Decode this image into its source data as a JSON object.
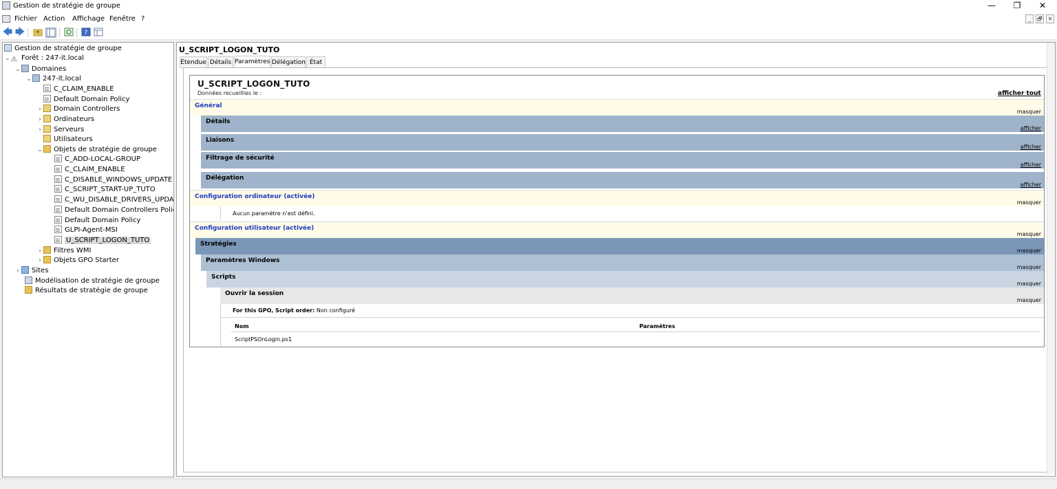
{
  "window": {
    "title": "Gestion de stratégie de groupe",
    "minimize": "—",
    "restore": "❐",
    "close": "✕"
  },
  "menu": {
    "items": [
      "Fichier",
      "Action",
      "Affichage",
      "Fenêtre",
      "?"
    ],
    "child_controls": [
      "_",
      "🗗",
      "✕"
    ]
  },
  "toolbar": {
    "back": "🡄",
    "forward": "🡆",
    "icons": [
      "up-folder-icon",
      "show-hide-tree-icon",
      "refresh-icon",
      "help-icon",
      "properties-icon"
    ]
  },
  "tree": {
    "root": "Gestion de stratégie de groupe",
    "forest": "Forêt : 247-it.local",
    "domains": "Domaines",
    "domain": "247-it.local",
    "domain_children": [
      "C_CLAIM_ENABLE",
      "Default Domain Policy",
      "Domain Controllers",
      "Ordinateurs",
      "Serveurs",
      "Utilisateurs",
      "Objets de stratégie de groupe"
    ],
    "gpos": [
      "C_ADD-LOCAL-GROUP",
      "C_CLAIM_ENABLE",
      "C_DISABLE_WINDOWS_UPDATE",
      "C_SCRIPT_START-UP_TUTO",
      "C_WU_DISABLE_DRIVERS_UPDATE",
      "Default Domain Controllers Policy",
      "Default Domain Policy",
      "GLPI-Agent-MSI",
      "U_SCRIPT_LOGON_TUTO"
    ],
    "wmi_filters": "Filtres WMI",
    "starter_gpos": "Objets GPO Starter",
    "sites": "Sites",
    "modeling": "Modélisation de stratégie de groupe",
    "results": "Résultats de stratégie de groupe"
  },
  "details": {
    "gpo_name": "U_SCRIPT_LOGON_TUTO",
    "tabs": [
      "Étendue",
      "Détails",
      "Paramètres",
      "Délégation",
      "État"
    ],
    "active_tab": "Paramètres"
  },
  "report": {
    "title": "U_SCRIPT_LOGON_TUTO",
    "collected": "Données recueillies le :",
    "show_all": "afficher tout",
    "general": "Général",
    "hide": "masquer",
    "show": "afficher",
    "general_sections": [
      "Détails",
      "Liaisons",
      "Filtrage de sécurité",
      "Délégation"
    ],
    "computer_config": "Configuration ordinateur (activée)",
    "no_settings": "Aucun paramètre n’est défini.",
    "user_config": "Configuration utilisateur (activée)",
    "policies": "Stratégies",
    "windows_settings": "Paramètres Windows",
    "scripts": "Scripts",
    "logon": "Ouvrir la session",
    "script_order_label": "For this GPO, Script order:",
    "script_order_value": "Non configuré",
    "col_name": "Nom",
    "col_params": "Paramètres",
    "script_file": "ScriptPSOnLogin.ps1"
  }
}
